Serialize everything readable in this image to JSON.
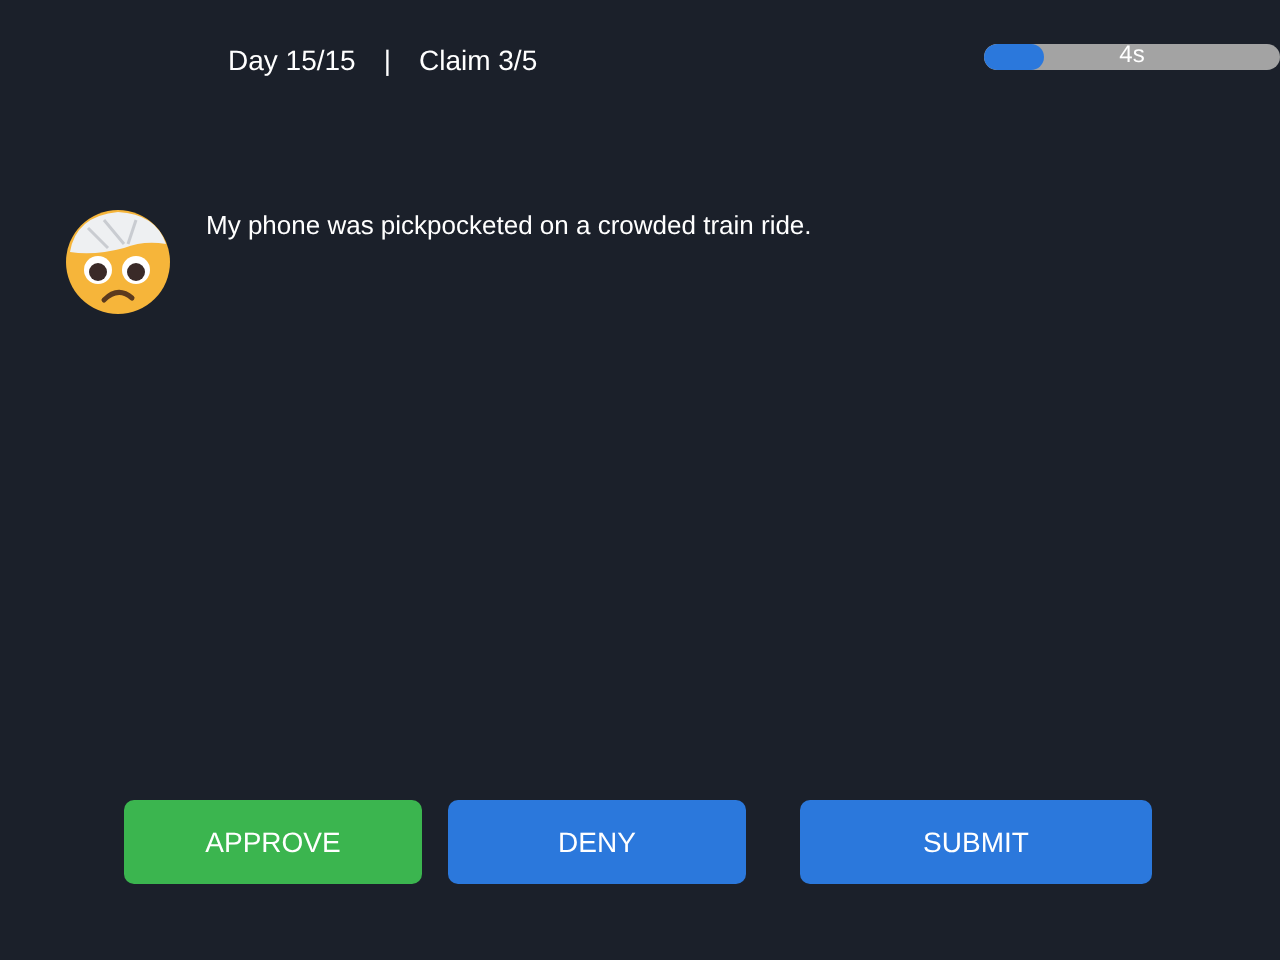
{
  "header": {
    "day": "Day 15/15",
    "separator": "|",
    "claim": "Claim 3/5"
  },
  "timer": {
    "level": 0.2,
    "reading": "4s"
  },
  "claim": {
    "text": "My phone was pickpocketed on a crowded train ride."
  },
  "buttons": [
    {
      "label": "APPROVE",
      "kind": "approve"
    },
    {
      "label": "DENY",
      "kind": "deny"
    },
    {
      "label": "SUBMIT",
      "kind": "submit"
    }
  ]
}
